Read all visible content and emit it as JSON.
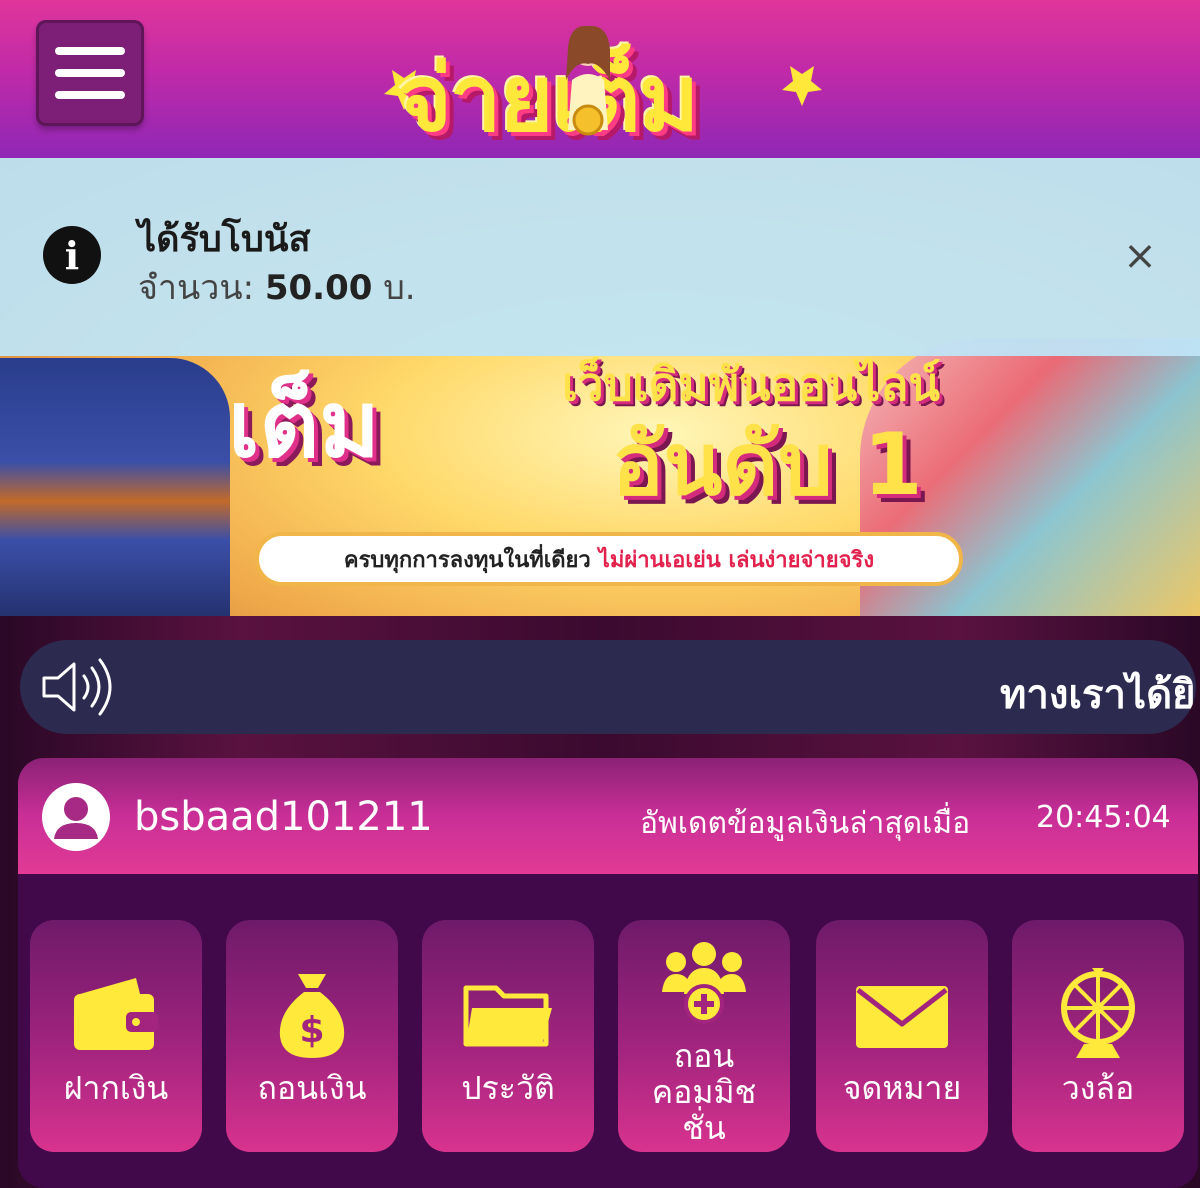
{
  "header": {
    "menu_icon": "hamburger-icon",
    "logo_text": "จ่ายเต็ม"
  },
  "banner": {
    "word_left": "เต็ม",
    "line2": "เว็บเดิมพันออนไลน์",
    "line3": "อันดับ 1",
    "tagline_black": "ครบทุกการลงทุนในที่เดียว",
    "tagline_red": "ไม่ผ่านเอเย่น เล่นง่ายจ่ายจริง"
  },
  "toast": {
    "icon": "info-icon",
    "title": "ได้รับโบนัส",
    "amount_label": "จำนวน:",
    "amount_value": "50.00",
    "amount_unit": "บ.",
    "close_symbol": "×"
  },
  "marquee": {
    "icon": "speaker-icon",
    "text": "ทางเราได้ยิ"
  },
  "account": {
    "avatar_icon": "user-avatar-icon",
    "username": "bsbaad101211",
    "update_label": "อัพเดตข้อมูลเงินล่าสุดเมื่อ",
    "update_time": "20:45:04"
  },
  "menu_tiles": [
    {
      "label": "ฝากเงิน",
      "icon": "wallet-icon"
    },
    {
      "label": "ถอนเงิน",
      "icon": "money-bag-icon"
    },
    {
      "label": "ประวัติ",
      "icon": "folder-icon"
    },
    {
      "label": "ถอน\nคอมมิช\nชั่น",
      "icon": "group-add-icon"
    },
    {
      "label": "จดหมาย",
      "icon": "envelope-icon"
    },
    {
      "label": "วงล้อ",
      "icon": "wheel-icon"
    }
  ],
  "colors": {
    "accent_yellow": "#ffe93b",
    "header_pink": "#e0359b",
    "toast_bg": "#bee4f6",
    "marquee_bg": "#2c2a4f",
    "panel_bg": "#42094a"
  }
}
